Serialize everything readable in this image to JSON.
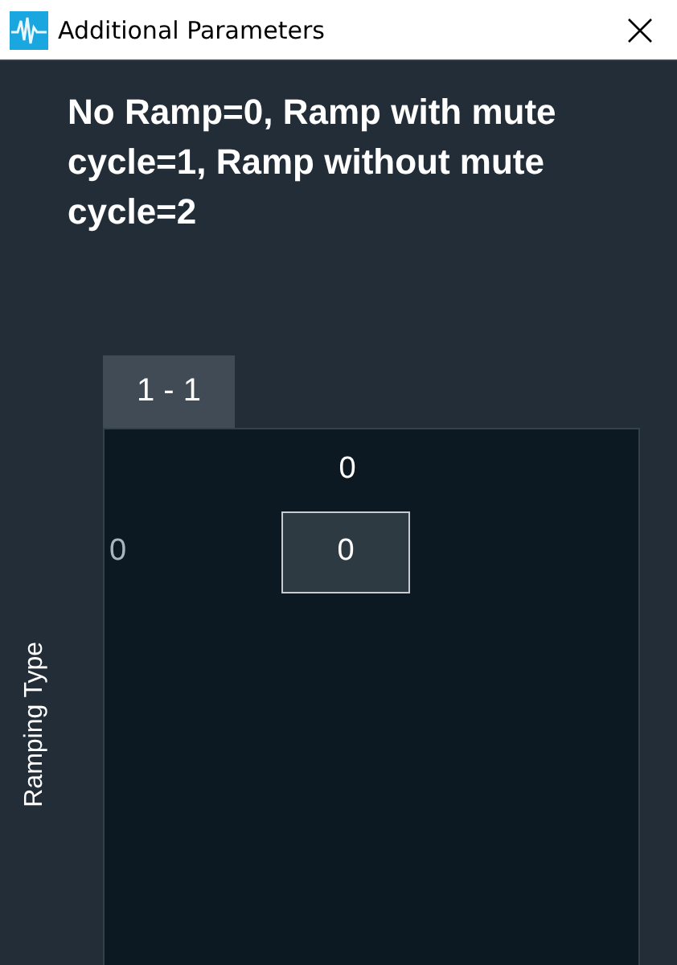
{
  "window": {
    "title": "Additional Parameters"
  },
  "description": "No Ramp=0, Ramp with mute cycle=1, Ramp without mute cycle=2",
  "tabs": [
    {
      "label": "1 - 1",
      "selected": true
    }
  ],
  "table": {
    "row_axis_label": "Ramping Type",
    "columns": [
      "0"
    ],
    "rows": [
      {
        "header": "0",
        "cells": [
          "0"
        ]
      }
    ]
  }
}
